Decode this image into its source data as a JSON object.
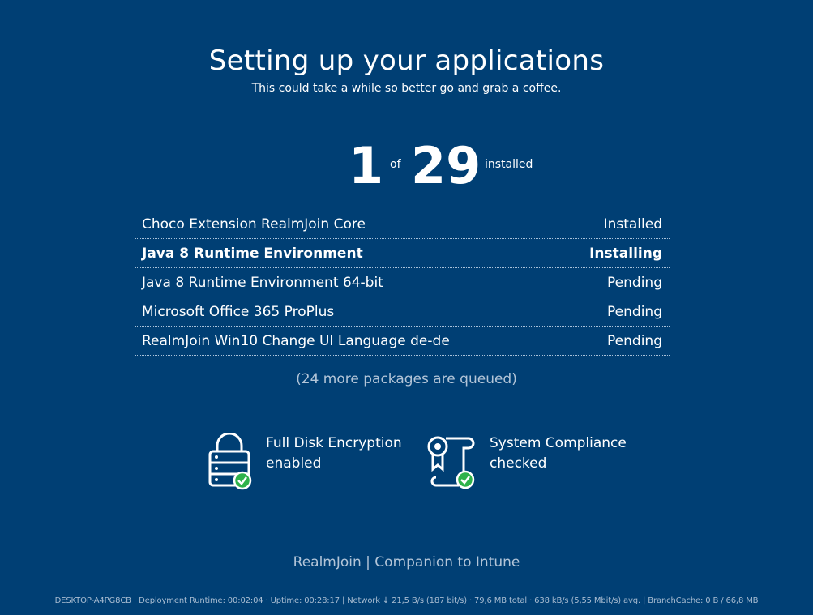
{
  "header": {
    "title": "Setting up your applications",
    "subtitle": "This could take a while so better go and grab a coffee."
  },
  "progress": {
    "current": "1",
    "of_label": "of",
    "total": "29",
    "installed_label": "installed"
  },
  "packages": [
    {
      "name": "Choco Extension RealmJoin Core",
      "status": "Installed"
    },
    {
      "name": "Java 8 Runtime Environment",
      "status": "Installing"
    },
    {
      "name": "Java 8 Runtime Environment 64-bit",
      "status": "Pending"
    },
    {
      "name": "Microsoft Office 365 ProPlus",
      "status": "Pending"
    },
    {
      "name": "RealmJoin Win10 Change UI Language de-de",
      "status": "Pending"
    }
  ],
  "queued_text": "(24 more packages are queued)",
  "badges": [
    {
      "icon": "lock-icon",
      "line1": "Full Disk Encryption",
      "line2": "enabled"
    },
    {
      "icon": "certificate-icon",
      "line1": "System Compliance",
      "line2": "checked"
    }
  ],
  "footer": {
    "brand": "RealmJoin | Companion to Intune",
    "status": "DESKTOP-A4PG8CB | Deployment Runtime: 00:02:04 · Uptime: 00:28:17 | Network ↓ 21,5 B/s (187 bit/s) · 79,6 MB total · 638 kB/s (5,55 Mbit/s) avg. | BranchCache: 0 B / 66,8 MB"
  },
  "colors": {
    "background": "#003f74",
    "text": "#ffffff",
    "muted_text": "#b3c5d8",
    "check_green": "#2fb24a"
  }
}
